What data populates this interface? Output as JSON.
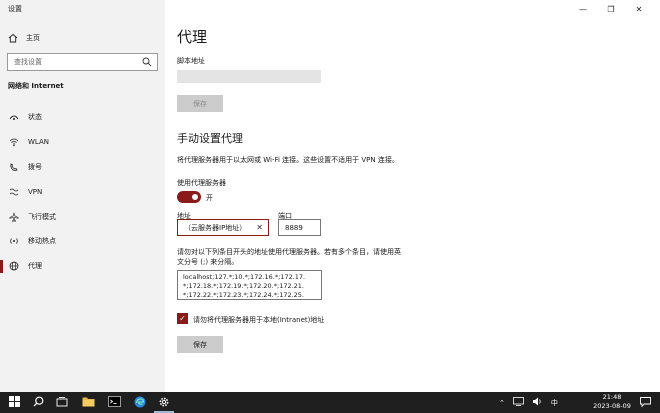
{
  "window": {
    "title": "设置",
    "minimize": "—",
    "maximize": "❐",
    "close": "✕"
  },
  "sidebar": {
    "home": "主页",
    "search_placeholder": "查找设置",
    "category": "网络和 Internet",
    "items": [
      {
        "label": "状态",
        "icon": "status-icon"
      },
      {
        "label": "WLAN",
        "icon": "wifi-icon"
      },
      {
        "label": "拨号",
        "icon": "dialup-icon"
      },
      {
        "label": "VPN",
        "icon": "vpn-icon"
      },
      {
        "label": "飞行模式",
        "icon": "airplane-icon"
      },
      {
        "label": "移动热点",
        "icon": "hotspot-icon"
      },
      {
        "label": "代理",
        "icon": "proxy-globe-icon",
        "active": true
      }
    ]
  },
  "main": {
    "title": "代理",
    "script_label": "脚本地址",
    "save_script": "保存",
    "manual_heading": "手动设置代理",
    "manual_desc": "将代理服务器用于以太网或 Wi-Fi 连接。这些设置不适用于 VPN 连接。",
    "use_proxy_label": "使用代理服务器",
    "toggle_state": "开",
    "address_label": "地址",
    "address_value": "（云服务器IP地址）",
    "port_label": "端口",
    "port_value": "8889",
    "exceptions_desc_1": "请勿对以下列条目开头的地址使用代理服务器。若有多个条目，请使用英",
    "exceptions_desc_2": "文分号 (;) 来分隔。",
    "exceptions_line_1": "localhost;127.*;10.*;172.16.*;172.17.",
    "exceptions_line_2": "*;172.18.*;172.19.*;172.20.*;172.21.",
    "exceptions_line_3": "*;172.22.*;172.23.*;172.24.*;172.25.",
    "bypass_local_label": "请勿将代理服务器用于本地(Intranet)地址",
    "save_button": "保存"
  },
  "taskbar": {
    "ime": "中",
    "time": "21:48",
    "date": "2023-08-09",
    "accent": "#8b1a1a"
  }
}
